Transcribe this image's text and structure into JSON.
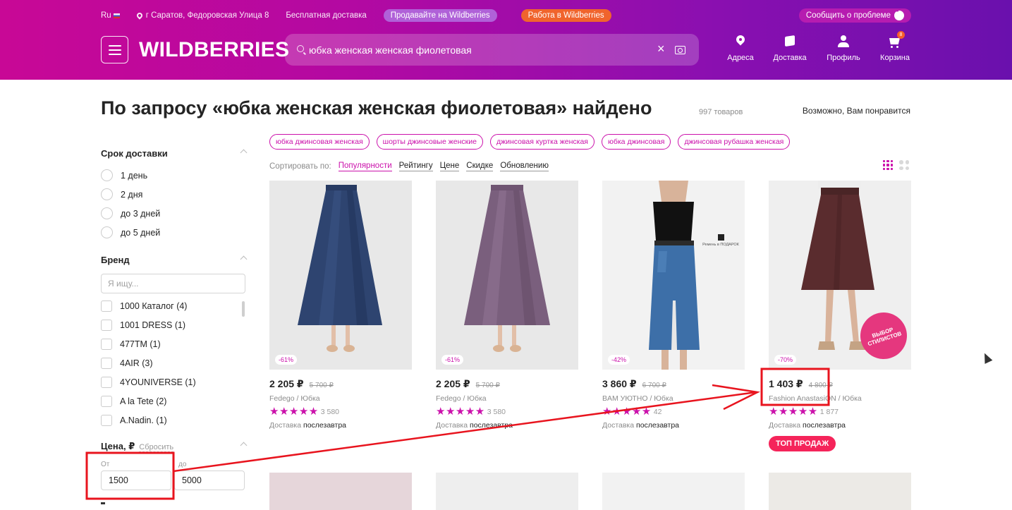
{
  "header": {
    "lang": "Ru",
    "location": "г Саратов, Федоровская Улица 8",
    "free_delivery": "Бесплатная доставка",
    "sell_label": "Продавайте на Wildberries",
    "work_label": "Работа в Wildberries",
    "report_label": "Сообщить о проблеме",
    "logo": "WILDBERRIES",
    "search_value": "юбка женская женская фиолетовая",
    "nav": {
      "addresses": "Адреса",
      "delivery": "Доставка",
      "profile": "Профиль",
      "cart": "Корзина",
      "cart_count": "8"
    }
  },
  "main": {
    "title": "По запросу «юбка женская женская фиолетовая» найдено",
    "count": "997 товаров",
    "maybe_like": "Возможно, Вам понравится"
  },
  "tags": [
    "юбка джинсовая женская",
    "шорты джинсовые женские",
    "джинсовая куртка женская",
    "юбка джинсовая",
    "джинсовая рубашка женская"
  ],
  "sorting": {
    "label": "Сортировать по:",
    "options": [
      "Популярности",
      "Рейтингу",
      "Цене",
      "Скидке",
      "Обновлению"
    ]
  },
  "filters": {
    "delivery_title": "Срок доставки",
    "delivery_options": [
      "1 день",
      "2 дня",
      "до 3 дней",
      "до 5 дней"
    ],
    "brand_title": "Бренд",
    "brand_placeholder": "Я ищу...",
    "brands": [
      "1000 Каталог (4)",
      "1001 DRESS (1)",
      "477TM (1)",
      "4AIR (3)",
      "4YOUNIVERSE (1)",
      "A la Tete (2)",
      "A.Nadin. (1)"
    ],
    "price_title": "Цена, ₽",
    "price_reset": "Сбросить",
    "price_from_label": "От",
    "price_to_label": "до",
    "price_from": "1500",
    "price_to": "5000"
  },
  "products": [
    {
      "discount": "-61%",
      "price": "2 205 ₽",
      "old_price": "5 700 ₽",
      "brand": "Fedego / Юбка",
      "stars": "★★★★★",
      "reviews": "3 580",
      "delivery_label": "Доставка",
      "delivery_when": "послезавтра"
    },
    {
      "discount": "-61%",
      "price": "2 205 ₽",
      "old_price": "5 700 ₽",
      "brand": "Fedego / Юбка",
      "stars": "★★★★★",
      "reviews": "3 580",
      "delivery_label": "Доставка",
      "delivery_when": "послезавтра"
    },
    {
      "discount": "-42%",
      "price": "3 860 ₽",
      "old_price": "6 700 ₽",
      "brand": "BAM УЮТНО / Юбка",
      "stars": "★★★★★",
      "reviews": "42",
      "delivery_label": "Доставка",
      "delivery_when": "послезавтра",
      "gift_note": "Ремень в ПОДАРОК"
    },
    {
      "discount": "-70%",
      "price": "1 403 ₽",
      "old_price": "4 800 ₽",
      "brand": "Fashion AnastasiON / Юбка",
      "stars": "★★★★★",
      "reviews": "1 877",
      "delivery_label": "Доставка",
      "delivery_when": "послезавтра",
      "badge": "ТОП ПРОДАЖ",
      "stylist": "ВЫБОР СТИЛИСТОВ"
    }
  ],
  "colors": {
    "brand": "#cb11ab",
    "accent": "#f5245a",
    "annotation": "#e8141e"
  }
}
